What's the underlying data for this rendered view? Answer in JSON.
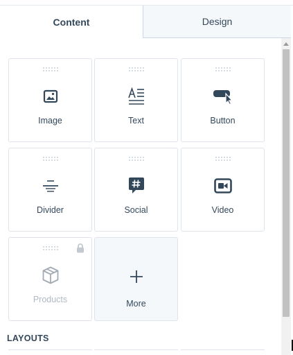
{
  "tabs": [
    {
      "label": "Content",
      "active": true
    },
    {
      "label": "Design",
      "active": false
    }
  ],
  "modules": [
    {
      "label": "Image",
      "icon": "image-icon"
    },
    {
      "label": "Text",
      "icon": "text-icon"
    },
    {
      "label": "Button",
      "icon": "button-cursor-icon"
    },
    {
      "label": "Divider",
      "icon": "divider-icon"
    },
    {
      "label": "Social",
      "icon": "social-hashtag-icon"
    },
    {
      "label": "Video",
      "icon": "video-icon"
    },
    {
      "label": "Products",
      "icon": "box-icon",
      "locked": true,
      "disabled": true
    },
    {
      "label": "More",
      "icon": "plus-icon"
    }
  ],
  "layouts": {
    "title": "LAYOUTS"
  },
  "colors": {
    "text": "#33475b",
    "icon": "#33475b",
    "border": "#dfe3eb",
    "inactive_tab_bg": "#f5f8fa",
    "muted": "#b0bac5"
  }
}
